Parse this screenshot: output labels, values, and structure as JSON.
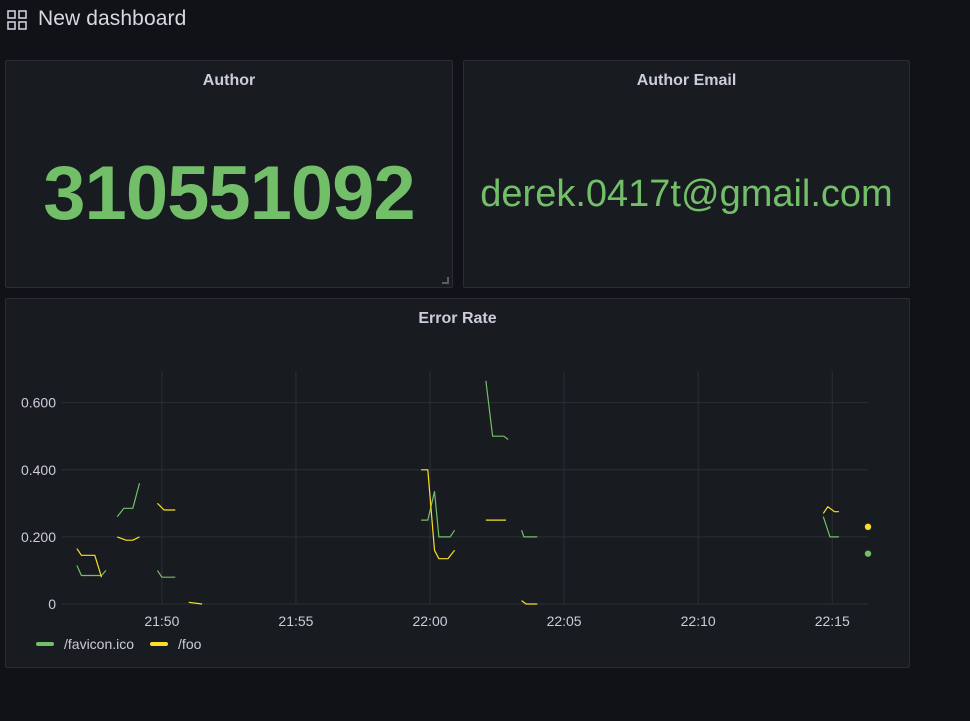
{
  "header": {
    "title": "New dashboard",
    "icon": "grid-icon"
  },
  "panels": {
    "author": {
      "title": "Author",
      "value": "310551092"
    },
    "author_email": {
      "title": "Author Email",
      "value": "derek.0417t@gmail.com"
    },
    "error_rate": {
      "title": "Error Rate"
    }
  },
  "colors": {
    "background": "#111217",
    "panel": "#181b1f",
    "green": "#73bf69",
    "yellow": "#fade2a",
    "grid": "#2c2f35"
  },
  "chart_data": {
    "type": "line",
    "title": "Error Rate",
    "xlabel": "",
    "ylabel": "",
    "x_ticks": [
      "21:50",
      "21:55",
      "22:00",
      "22:05",
      "22:10",
      "22:15"
    ],
    "y_ticks": [
      "0",
      "0.200",
      "0.400",
      "0.600"
    ],
    "ylim": [
      0,
      0.73
    ],
    "xlim": [
      "21:46:30",
      "22:16:20"
    ],
    "grid": true,
    "legend": "bottom-left",
    "series": [
      {
        "name": "/favicon.ico",
        "color": "#73bf69",
        "segments": [
          [
            [
              "21:46:50",
              0.115
            ],
            [
              "21:47:00",
              0.085
            ],
            [
              "21:47:45",
              0.085
            ],
            [
              "21:47:55",
              0.1
            ]
          ],
          [
            [
              "21:48:20",
              0.26
            ],
            [
              "21:48:35",
              0.285
            ],
            [
              "21:48:55",
              0.285
            ],
            [
              "21:49:10",
              0.36
            ]
          ],
          [
            [
              "21:49:50",
              0.1
            ],
            [
              "21:50:00",
              0.08
            ],
            [
              "21:50:30",
              0.08
            ]
          ],
          [
            [
              "21:59:40",
              0.25
            ],
            [
              "21:59:55",
              0.25
            ],
            [
              "22:00:10",
              0.335
            ],
            [
              "22:00:20",
              0.2
            ],
            [
              "22:00:45",
              0.2
            ],
            [
              "22:00:55",
              0.22
            ]
          ],
          [
            [
              "22:02:05",
              0.665
            ],
            [
              "22:02:20",
              0.5
            ],
            [
              "22:02:45",
              0.5
            ],
            [
              "22:02:55",
              0.49
            ]
          ],
          [
            [
              "22:03:25",
              0.22
            ],
            [
              "22:03:30",
              0.2
            ],
            [
              "22:04:00",
              0.2
            ]
          ],
          [
            [
              "22:14:40",
              0.26
            ],
            [
              "22:14:55",
              0.2
            ],
            [
              "22:15:15",
              0.2
            ]
          ]
        ],
        "last_point": [
          "22:16:20",
          0.15
        ]
      },
      {
        "name": "/foo",
        "color": "#fade2a",
        "segments": [
          [
            [
              "21:46:50",
              0.165
            ],
            [
              "21:47:00",
              0.145
            ],
            [
              "21:47:30",
              0.145
            ],
            [
              "21:47:45",
              0.08
            ]
          ],
          [
            [
              "21:48:20",
              0.2
            ],
            [
              "21:48:40",
              0.19
            ],
            [
              "21:48:55",
              0.19
            ],
            [
              "21:49:10",
              0.2
            ]
          ],
          [
            [
              "21:49:50",
              0.3
            ],
            [
              "21:50:05",
              0.28
            ],
            [
              "21:50:30",
              0.28
            ]
          ],
          [
            [
              "21:51:00",
              0.005
            ],
            [
              "21:51:30",
              0.0
            ]
          ],
          [
            [
              "21:59:40",
              0.4
            ],
            [
              "21:59:55",
              0.4
            ],
            [
              "22:00:10",
              0.16
            ],
            [
              "22:00:20",
              0.135
            ],
            [
              "22:00:40",
              0.135
            ],
            [
              "22:00:55",
              0.16
            ]
          ],
          [
            [
              "22:02:05",
              0.25
            ],
            [
              "22:02:50",
              0.25
            ]
          ],
          [
            [
              "22:03:25",
              0.01
            ],
            [
              "22:03:35",
              0.0
            ],
            [
              "22:04:00",
              0.0
            ]
          ],
          [
            [
              "22:14:40",
              0.27
            ],
            [
              "22:14:50",
              0.29
            ],
            [
              "22:15:05",
              0.275
            ],
            [
              "22:15:15",
              0.275
            ]
          ]
        ],
        "last_point": [
          "22:16:20",
          0.23
        ]
      }
    ]
  }
}
